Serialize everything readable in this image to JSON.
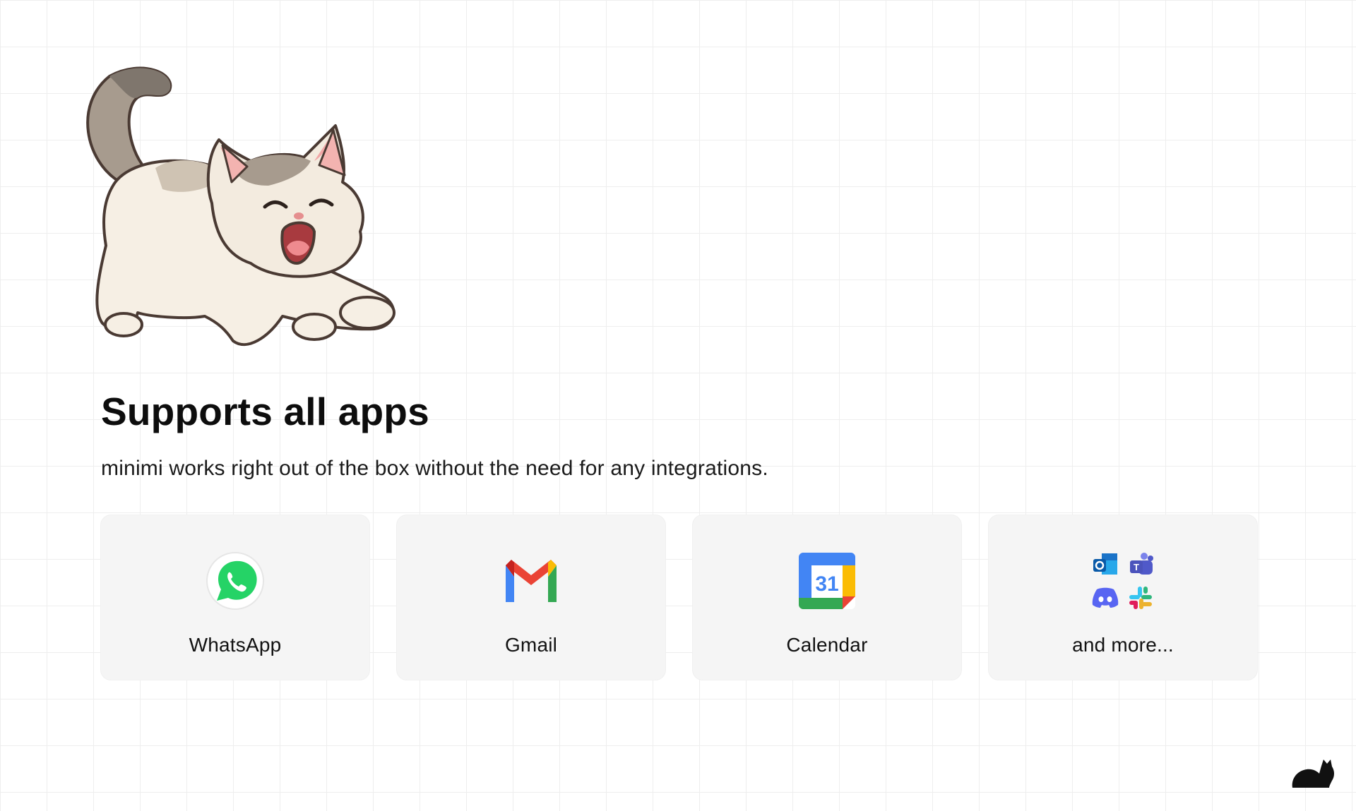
{
  "section": {
    "title": "Supports all apps",
    "description": "minimi works right out of the box without the need for any integrations."
  },
  "apps": [
    {
      "label": "WhatsApp",
      "icon": "whatsapp-icon",
      "color": "#25D366"
    },
    {
      "label": "Gmail",
      "icon": "gmail-icon",
      "color": "#EA4335"
    },
    {
      "label": "Calendar",
      "icon": "google-calendar-icon",
      "date": "31",
      "color": "#4285F4"
    },
    {
      "label": "and more...",
      "icon": "more-apps-icon",
      "sub_icons": [
        "outlook-icon",
        "teams-icon",
        "discord-icon",
        "slack-icon"
      ]
    }
  ],
  "colors": {
    "background": "#ffffff",
    "grid_line": "#eeeeee",
    "card_background": "#f5f5f5",
    "text": "#111111"
  }
}
